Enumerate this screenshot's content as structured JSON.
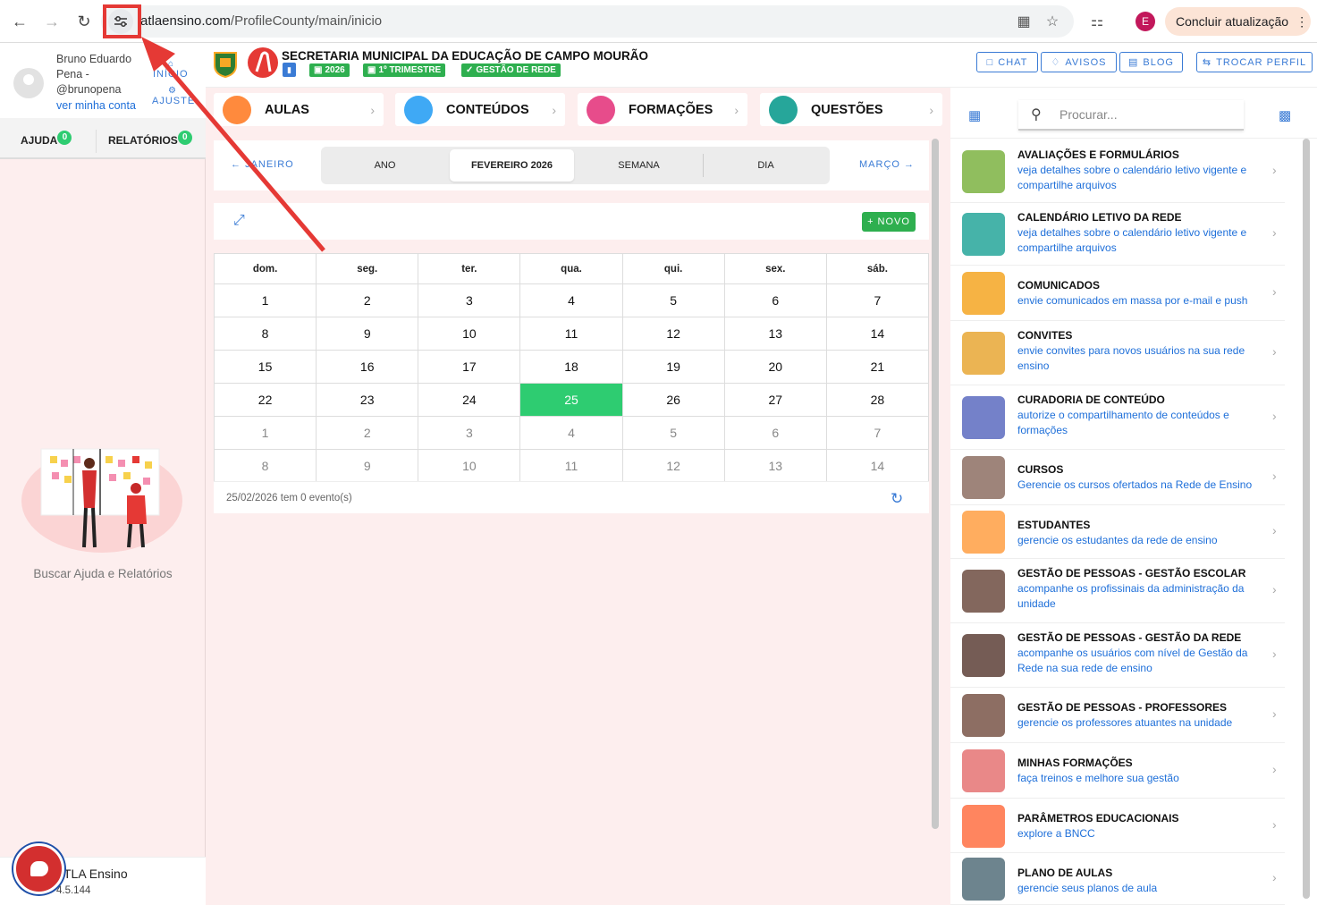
{
  "browser": {
    "url_prefix": "",
    "url_domain": "atlaensino.com",
    "url_path": "/ProfileCounty/main/inicio",
    "update_label": "Concluir atualização",
    "profile_initial": "E"
  },
  "sidebar": {
    "user_name_line1": "Bruno Eduardo",
    "user_name_line2": "Pena -",
    "user_handle": "@brunopena",
    "account_link": "ver minha conta",
    "nav_home": "INÍCIO",
    "nav_settings": "AJUSTE",
    "tab_help": "AJUDA",
    "tab_help_count": "0",
    "tab_reports": "RELATÓRIOS",
    "tab_reports_count": "0",
    "help_caption": "Buscar Ajuda e Relatórios",
    "app_name": "TLA Ensino",
    "app_version": "4.5.144"
  },
  "header": {
    "title": "SECRETARIA MUNICIPAL DA EDUCAÇÃO DE CAMPO MOURÃO",
    "badge_year": "2026",
    "badge_term": "1º TRIMESTRE",
    "badge_role": "GESTÃO DE REDE",
    "btn_chat": "CHAT",
    "btn_notices": "AVISOS",
    "btn_blog": "BLOG",
    "btn_switch": "TROCAR PERFIL"
  },
  "categories": [
    {
      "label": "AULAS",
      "color": "#ff8a3d"
    },
    {
      "label": "CONTEÚDOS",
      "color": "#3fa9f5"
    },
    {
      "label": "FORMAÇÕES",
      "color": "#e74c8b"
    },
    {
      "label": "QUESTÕES",
      "color": "#26a69a"
    }
  ],
  "calendar": {
    "prev_month": "JANEIRO",
    "next_month": "MARÇO",
    "views": [
      "ANO",
      "FEVEREIRO 2026",
      "SEMANA",
      "DIA"
    ],
    "active_view": "FEVEREIRO 2026",
    "new_label": "NOVO",
    "weekdays": [
      "dom.",
      "seg.",
      "ter.",
      "qua.",
      "qui.",
      "sex.",
      "sáb."
    ],
    "weeks": [
      [
        "1",
        "2",
        "3",
        "4",
        "5",
        "6",
        "7"
      ],
      [
        "8",
        "9",
        "10",
        "11",
        "12",
        "13",
        "14"
      ],
      [
        "15",
        "16",
        "17",
        "18",
        "19",
        "20",
        "21"
      ],
      [
        "22",
        "23",
        "24",
        "25",
        "26",
        "27",
        "28"
      ],
      [
        "1",
        "2",
        "3",
        "4",
        "5",
        "6",
        "7"
      ],
      [
        "8",
        "9",
        "10",
        "11",
        "12",
        "13",
        "14"
      ]
    ],
    "today": "25",
    "event_summary": "25/02/2026 tem 0 evento(s)"
  },
  "search": {
    "placeholder": "Procurar..."
  },
  "modules": [
    {
      "title": "AVALIAÇÕES E FORMULÁRIOS",
      "desc": "veja detalhes sobre o calendário letivo vigente e compartilhe arquivos",
      "color": "#7cb342"
    },
    {
      "title": "CALENDÁRIO LETIVO DA REDE",
      "desc": "veja detalhes sobre o calendário letivo vigente e compartilhe arquivos",
      "color": "#26a69a"
    },
    {
      "title": "COMUNICADOS",
      "desc": "envie comunicados em massa por e-mail e push",
      "color": "#f5a623"
    },
    {
      "title": "CONVITES",
      "desc": "envie convites para novos usuários na sua rede ensino",
      "color": "#e8a735"
    },
    {
      "title": "CURADORIA DE CONTEÚDO",
      "desc": "autorize o compartilhamento de conteúdos e formações",
      "color": "#5c6bc0"
    },
    {
      "title": "CURSOS",
      "desc": "Gerencie os cursos ofertados na Rede de Ensino",
      "color": "#8d6e63"
    },
    {
      "title": "ESTUDANTES",
      "desc": "gerencie os estudantes da rede de ensino",
      "color": "#ff9f43"
    },
    {
      "title": "GESTÃO DE PESSOAS - GESTÃO ESCOLAR",
      "desc": "acompanhe os profissinais da administração da unidade",
      "color": "#6d4c41"
    },
    {
      "title": "GESTÃO DE PESSOAS - GESTÃO DA REDE",
      "desc": "acompanhe os usuários com nível de Gestão da Rede na sua rede de ensino",
      "color": "#5d4037"
    },
    {
      "title": "GESTÃO DE PESSOAS - PROFESSORES",
      "desc": "gerencie os professores atuantes na unidade",
      "color": "#795548"
    },
    {
      "title": "MINHAS FORMAÇÕES",
      "desc": "faça treinos e melhore sua gestão",
      "color": "#e57373"
    },
    {
      "title": "PARÂMETROS EDUCACIONAIS",
      "desc": "explore a BNCC",
      "color": "#ff7043"
    },
    {
      "title": "PLANO DE AULAS",
      "desc": "gerencie seus planos de aula",
      "color": "#546e7a"
    }
  ],
  "colors": {
    "accent_blue": "#3a7bd5",
    "success_green": "#2ecc71",
    "annotation_red": "#e53935"
  }
}
